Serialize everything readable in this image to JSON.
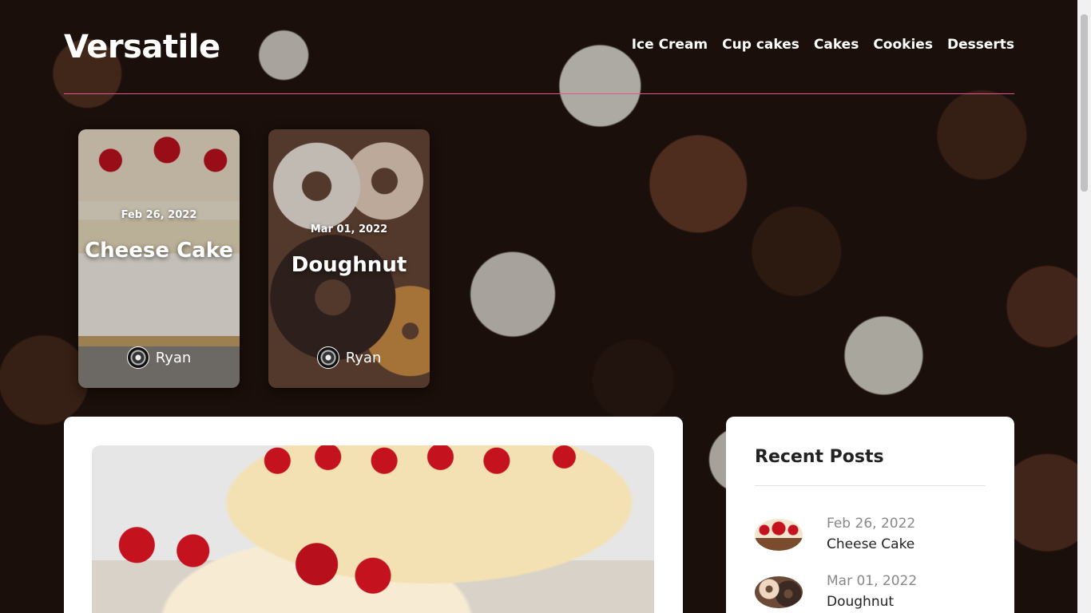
{
  "site": {
    "logo": "Versatile"
  },
  "nav": {
    "items": [
      {
        "label": "Ice Cream"
      },
      {
        "label": "Cup cakes"
      },
      {
        "label": "Cakes"
      },
      {
        "label": "Cookies"
      },
      {
        "label": "Desserts"
      }
    ]
  },
  "featured": [
    {
      "date": "Feb 26, 2022",
      "title": "Cheese Cake",
      "author": "Ryan"
    },
    {
      "date": "Mar 01, 2022",
      "title": "Doughnut",
      "author": "Ryan"
    }
  ],
  "sidebar": {
    "title": "Recent Posts",
    "posts": [
      {
        "date": "Feb 26, 2022",
        "title": "Cheese Cake"
      },
      {
        "date": "Mar 01, 2022",
        "title": "Doughnut"
      }
    ]
  }
}
